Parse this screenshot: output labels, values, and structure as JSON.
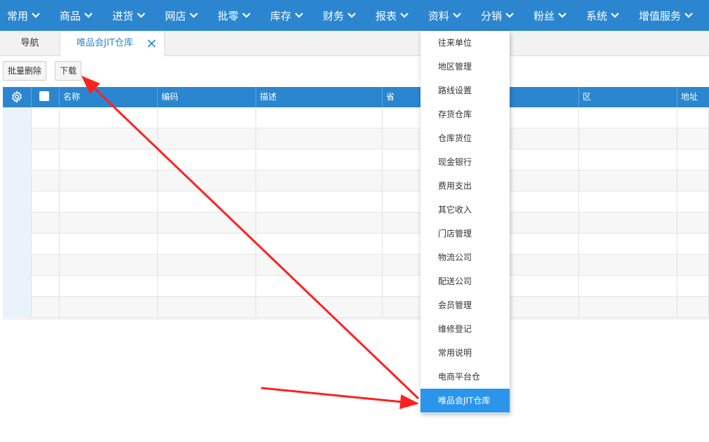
{
  "nav": {
    "items": [
      "常用",
      "商品",
      "进货",
      "网店",
      "批零",
      "库存",
      "财务",
      "报表",
      "资料",
      "分销",
      "粉丝",
      "系统",
      "增值服务"
    ]
  },
  "tabs": {
    "home": "导航",
    "active": "唯品会JIT仓库"
  },
  "toolbar": {
    "batch_delete": "批量删除",
    "download": "下载"
  },
  "grid": {
    "columns": [
      "名称",
      "编码",
      "描述",
      "省",
      "",
      "区",
      "地址"
    ],
    "row_count": 10
  },
  "dropdown": {
    "items": [
      "往来单位",
      "地区管理",
      "路线设置",
      "存货仓库",
      "仓库货位",
      "现金银行",
      "费用支出",
      "其它收入",
      "门店管理",
      "物流公司",
      "配送公司",
      "会员管理",
      "维修登记",
      "常用说明",
      "电商平台仓",
      "唯品会JIT仓库"
    ],
    "active_index": 15
  },
  "colors": {
    "nav_bg": "#2b86cf",
    "active_item_bg": "#2b95ec",
    "annotation_arrow": "#ff2020"
  }
}
